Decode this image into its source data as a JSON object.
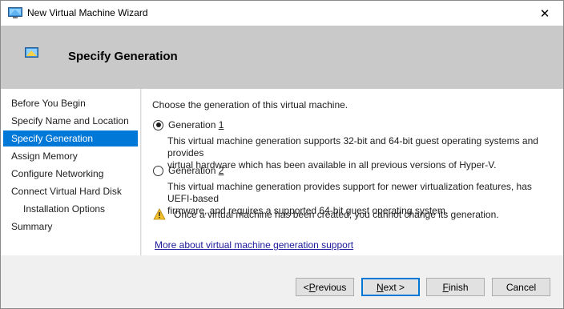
{
  "window": {
    "title": "New Virtual Machine Wizard",
    "close_glyph": "✕"
  },
  "header": {
    "title": "Specify Generation"
  },
  "steps": [
    {
      "label": "Before You Begin"
    },
    {
      "label": "Specify Name and Location"
    },
    {
      "label": "Specify Generation",
      "active": true
    },
    {
      "label": "Assign Memory"
    },
    {
      "label": "Configure Networking"
    },
    {
      "label": "Connect Virtual Hard Disk"
    },
    {
      "label": "Installation Options",
      "indent": true
    },
    {
      "label": "Summary"
    }
  ],
  "content": {
    "prompt": "Choose the generation of this virtual machine.",
    "gen1": {
      "label_prefix": "Generation ",
      "label_key": "1",
      "checked": true,
      "desc_line1": "This virtual machine generation supports 32-bit and 64-bit guest operating systems and provides",
      "desc_line2": "virtual hardware which has been available in all previous versions of Hyper-V."
    },
    "gen2": {
      "label_prefix": "Generation ",
      "label_key": "2",
      "checked": false,
      "desc_line1": "This virtual machine generation provides support for newer virtualization features, has UEFI-based",
      "desc_line2": "firmware, and requires a supported 64-bit guest operating system."
    },
    "warning": "Once a virtual machine has been created, you cannot change its generation.",
    "link": "More about virtual machine generation support"
  },
  "footer": {
    "previous": {
      "prefix": "< ",
      "key": "P",
      "rest": "revious"
    },
    "next": {
      "key": "N",
      "rest": "ext >"
    },
    "finish": {
      "key": "F",
      "rest": "inish"
    },
    "cancel": "Cancel"
  },
  "colors": {
    "accent": "#0078d7",
    "header_band": "#c9c9c9",
    "link": "#1a1a9b"
  },
  "icons": {
    "app": "hyper-v-vm-icon",
    "close": "close-icon",
    "warning": "warning-icon"
  }
}
